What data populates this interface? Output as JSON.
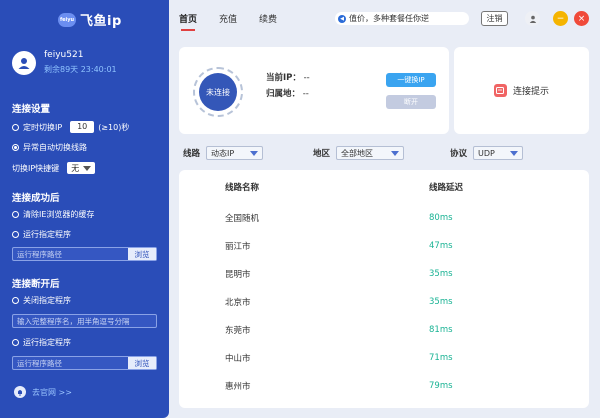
{
  "app": {
    "logo_mark": "feiyu",
    "logo_text": "飞鱼ip"
  },
  "user": {
    "name": "feiyu521",
    "expiry": "剩余89天 23:40:01"
  },
  "settings": {
    "title": "连接设置",
    "timed_switch_label": "定时切换IP",
    "timed_switch_value": "10",
    "timed_switch_unit": "(≥10)秒",
    "auto_switch_label": "异常自动切换线路",
    "hotkey_label": "切换IP快捷键",
    "hotkey_value": "无"
  },
  "on_connect": {
    "title": "连接成功后",
    "clear_cache_label": "清除IE浏览器的缓存",
    "run_program_label": "运行指定程序",
    "path_placeholder": "运行程序路径",
    "browse_label": "浏览"
  },
  "on_disconnect": {
    "title": "连接断开后",
    "close_program_label": "关闭指定程序",
    "close_placeholder": "输入完整程序名，用半角逗号分隔",
    "run_program_label": "运行指定程序",
    "path_placeholder": "运行程序路径",
    "browse_label": "浏览"
  },
  "footer": {
    "website_label": "去官网 >>"
  },
  "tabs": [
    {
      "label": "首页"
    },
    {
      "label": "充值"
    },
    {
      "label": "续费"
    }
  ],
  "notice": {
    "text": "值价，多种套餐任你逆"
  },
  "header": {
    "logout_label": "注销"
  },
  "connection": {
    "status": "未连接",
    "current_ip_label": "当前IP：",
    "current_ip_value": "--",
    "location_label": "归属地：",
    "location_value": "--",
    "connect_label": "一键换IP",
    "disconnect_label": "断开",
    "tip_label": "连接提示"
  },
  "filters": {
    "line_label": "线路",
    "line_value": "动态IP",
    "region_label": "地区",
    "region_value": "全部地区",
    "protocol_label": "协议",
    "protocol_value": "UDP"
  },
  "table": {
    "headers": [
      "线路名称",
      "线路延迟"
    ],
    "rows": [
      {
        "name": "全国随机",
        "latency": "80ms"
      },
      {
        "name": "丽江市",
        "latency": "47ms"
      },
      {
        "name": "昆明市",
        "latency": "35ms"
      },
      {
        "name": "北京市",
        "latency": "35ms"
      },
      {
        "name": "东莞市",
        "latency": "81ms"
      },
      {
        "name": "中山市",
        "latency": "71ms"
      },
      {
        "name": "惠州市",
        "latency": "79ms"
      }
    ]
  },
  "colors": {
    "sidebar": "#2a4db8",
    "accent_red": "#e04040",
    "latency_green": "#1ab394",
    "minimize": "#f5b400",
    "close": "#f04a3a",
    "avatar_btn": "#eef0f5"
  }
}
